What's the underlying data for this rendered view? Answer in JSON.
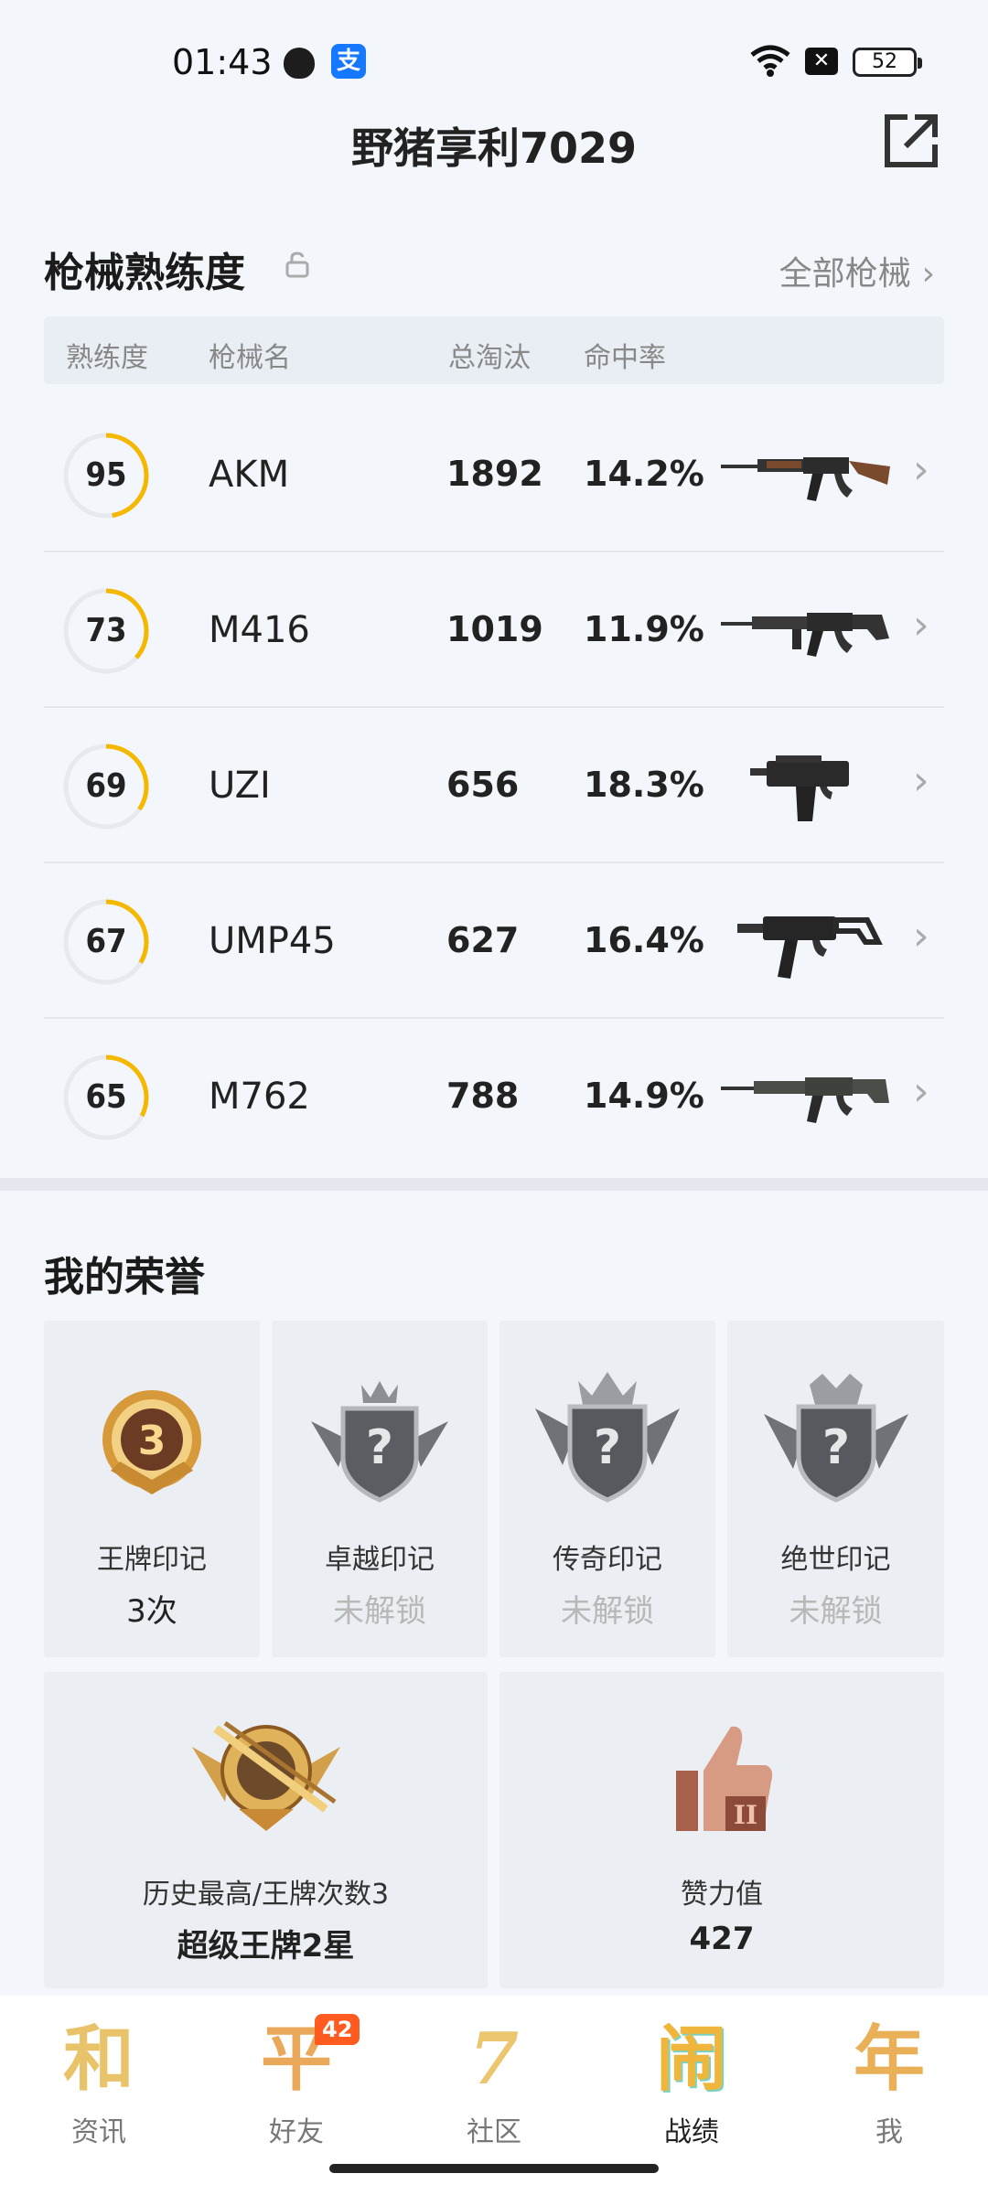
{
  "status_bar": {
    "time": "01:43",
    "battery": "52",
    "icons": [
      "shield-icon",
      "alipay-icon",
      "wifi-icon",
      "close-box-icon",
      "battery-icon"
    ]
  },
  "header": {
    "title": "野猪享利7029",
    "share_icon": "share-icon"
  },
  "weapons": {
    "title": "枪械熟练度",
    "all_label": "全部枪械",
    "columns": [
      "熟练度",
      "枪械名",
      "总淘汰",
      "命中率"
    ],
    "rows": [
      {
        "proficiency": "95",
        "proficiency_value": 95,
        "name": "AKM",
        "eliminations": "1892",
        "accuracy": "14.2%",
        "icon": "akm-rifle-icon"
      },
      {
        "proficiency": "73",
        "proficiency_value": 73,
        "name": "M416",
        "eliminations": "1019",
        "accuracy": "11.9%",
        "icon": "m416-rifle-icon"
      },
      {
        "proficiency": "69",
        "proficiency_value": 69,
        "name": "UZI",
        "eliminations": "656",
        "accuracy": "18.3%",
        "icon": "uzi-smg-icon"
      },
      {
        "proficiency": "67",
        "proficiency_value": 67,
        "name": "UMP45",
        "eliminations": "627",
        "accuracy": "16.4%",
        "icon": "ump45-smg-icon"
      },
      {
        "proficiency": "65",
        "proficiency_value": 65,
        "name": "M762",
        "eliminations": "788",
        "accuracy": "14.9%",
        "icon": "m762-rifle-icon"
      }
    ]
  },
  "honors": {
    "title": "我的荣誉",
    "marks": [
      {
        "label": "王牌印记",
        "value": "3次",
        "locked": false,
        "badge_number": "3"
      },
      {
        "label": "卓越印记",
        "value": "未解锁",
        "locked": true
      },
      {
        "label": "传奇印记",
        "value": "未解锁",
        "locked": true
      },
      {
        "label": "绝世印记",
        "value": "未解锁",
        "locked": true
      }
    ],
    "highest": {
      "label": "历史最高/王牌次数3",
      "value": "超级王牌2星"
    },
    "likes": {
      "label": "赞力值",
      "value": "427"
    }
  },
  "bottom_nav": {
    "items": [
      {
        "glyph": "和",
        "label": "资讯",
        "active": false
      },
      {
        "glyph": "平",
        "label": "好友",
        "active": false,
        "badge": "42"
      },
      {
        "glyph": "7",
        "label": "社区",
        "active": false
      },
      {
        "glyph": "闹",
        "label": "战绩",
        "active": true
      },
      {
        "glyph": "年",
        "label": "我",
        "active": false
      }
    ]
  },
  "colors": {
    "accent": "#f5b800",
    "ring_track": "#e6e9ee",
    "nav_gold": "#e9b64a",
    "badge": "#ff5a1f"
  }
}
